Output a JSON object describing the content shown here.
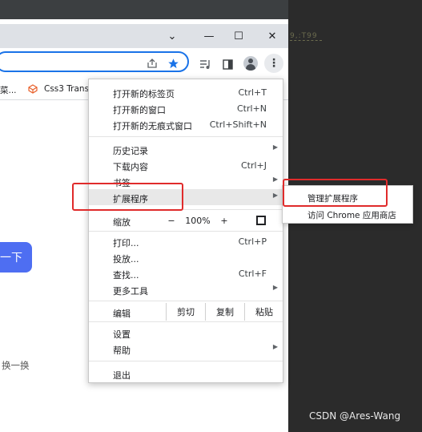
{
  "editor": {
    "ghost_text": "9,:T99"
  },
  "watermark": "CSDN @Ares-Wang",
  "window_controls": {
    "chevron": "⌄",
    "minimize": "—",
    "maximize": "☐",
    "close": "✕"
  },
  "toolbar_icons": [
    "share-icon",
    "star-icon",
    "media-icon",
    "sidepanel-icon",
    "profile-icon",
    "kebab-icon"
  ],
  "bookmarks": [
    {
      "label": "菜..."
    },
    {
      "label": "Css3 Trans"
    }
  ],
  "page": {
    "button_text": "一下",
    "link_text": "换一换"
  },
  "menu": {
    "new_tab": {
      "label": "打开新的标签页",
      "shortcut": "Ctrl+T"
    },
    "new_window": {
      "label": "打开新的窗口",
      "shortcut": "Ctrl+N"
    },
    "new_incognito": {
      "label": "打开新的无痕式窗口",
      "shortcut": "Ctrl+Shift+N"
    },
    "history": {
      "label": "历史记录"
    },
    "downloads": {
      "label": "下载内容",
      "shortcut": "Ctrl+J"
    },
    "bookmarks": {
      "label": "书签"
    },
    "extensions": {
      "label": "扩展程序"
    },
    "zoom": {
      "label": "缩放",
      "minus": "−",
      "value": "100%",
      "plus": "+"
    },
    "print": {
      "label": "打印...",
      "shortcut": "Ctrl+P"
    },
    "cast": {
      "label": "投放..."
    },
    "find": {
      "label": "查找...",
      "shortcut": "Ctrl+F"
    },
    "more_tools": {
      "label": "更多工具"
    },
    "edit": {
      "label": "编辑",
      "cut": "剪切",
      "copy": "复制",
      "paste": "粘贴"
    },
    "settings": {
      "label": "设置"
    },
    "help": {
      "label": "帮助"
    },
    "exit": {
      "label": "退出"
    }
  },
  "submenu": {
    "manage_extensions": "管理扩展程序",
    "visit_store": "访问 Chrome 应用商店"
  },
  "colors": {
    "annotation": "#e02b2b",
    "accent": "#1a73e8",
    "page_button": "#4e6ef2"
  }
}
